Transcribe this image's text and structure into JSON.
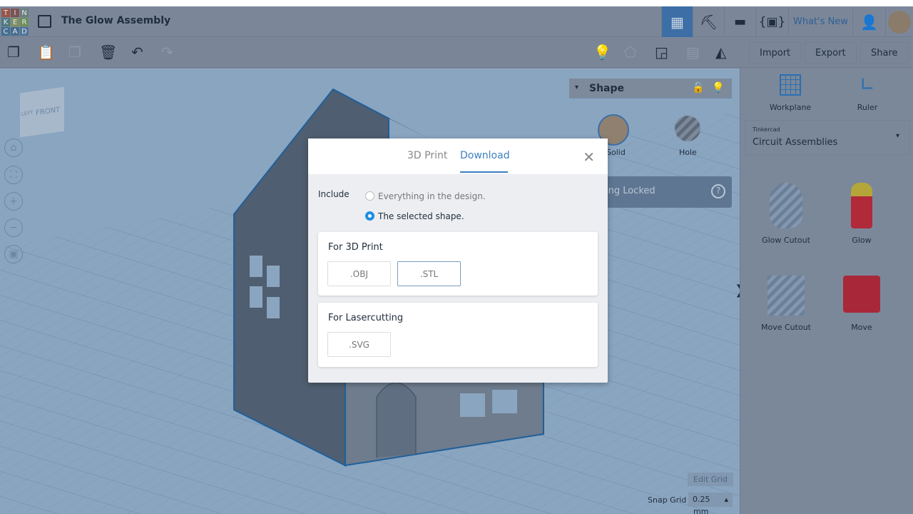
{
  "logo_letters": [
    "T",
    "I",
    "N",
    "K",
    "E",
    "R",
    "C",
    "A",
    "D"
  ],
  "logo_colors": [
    "#9a5548",
    "#7d5252",
    "#6b7e7d",
    "#4f7a80",
    "#7e8f5e",
    "#6e8f5a",
    "#436f92",
    "#456e8e",
    "#4f7397"
  ],
  "header": {
    "title": "The Glow Assembly",
    "whats_new": "What's New"
  },
  "toolbar": {
    "import": "Import",
    "export": "Export",
    "share": "Share"
  },
  "shape_panel": {
    "title": "Shape",
    "solid": "Solid",
    "hole": "Hole",
    "scaling": "Scaling Locked"
  },
  "right_panel": {
    "workplane": "Workplane",
    "ruler": "Ruler",
    "library_source": "Tinkercad",
    "library_name": "Circuit Assemblies",
    "parts": [
      {
        "label": "Glow Cutout"
      },
      {
        "label": "Glow"
      },
      {
        "label": "Move Cutout"
      },
      {
        "label": "Move"
      }
    ]
  },
  "viewcube": {
    "front": "FRONT",
    "left": "LEFT"
  },
  "grid": {
    "edit": "Edit Grid",
    "snap_label": "Snap Grid",
    "snap_value": "0.25",
    "snap_unit": "mm"
  },
  "modal": {
    "tabs": [
      {
        "label": "3D Print",
        "active": false
      },
      {
        "label": "Download",
        "active": true
      }
    ],
    "include_label": "Include",
    "options": [
      {
        "label": "Everything in the design.",
        "selected": false
      },
      {
        "label": "The selected shape.",
        "selected": true
      }
    ],
    "sections": [
      {
        "title": "For 3D Print",
        "formats": [
          ".OBJ",
          ".STL"
        ]
      },
      {
        "title": "For Lasercutting",
        "formats": [
          ".SVG"
        ]
      }
    ],
    "accent": "#3d7fc0"
  }
}
